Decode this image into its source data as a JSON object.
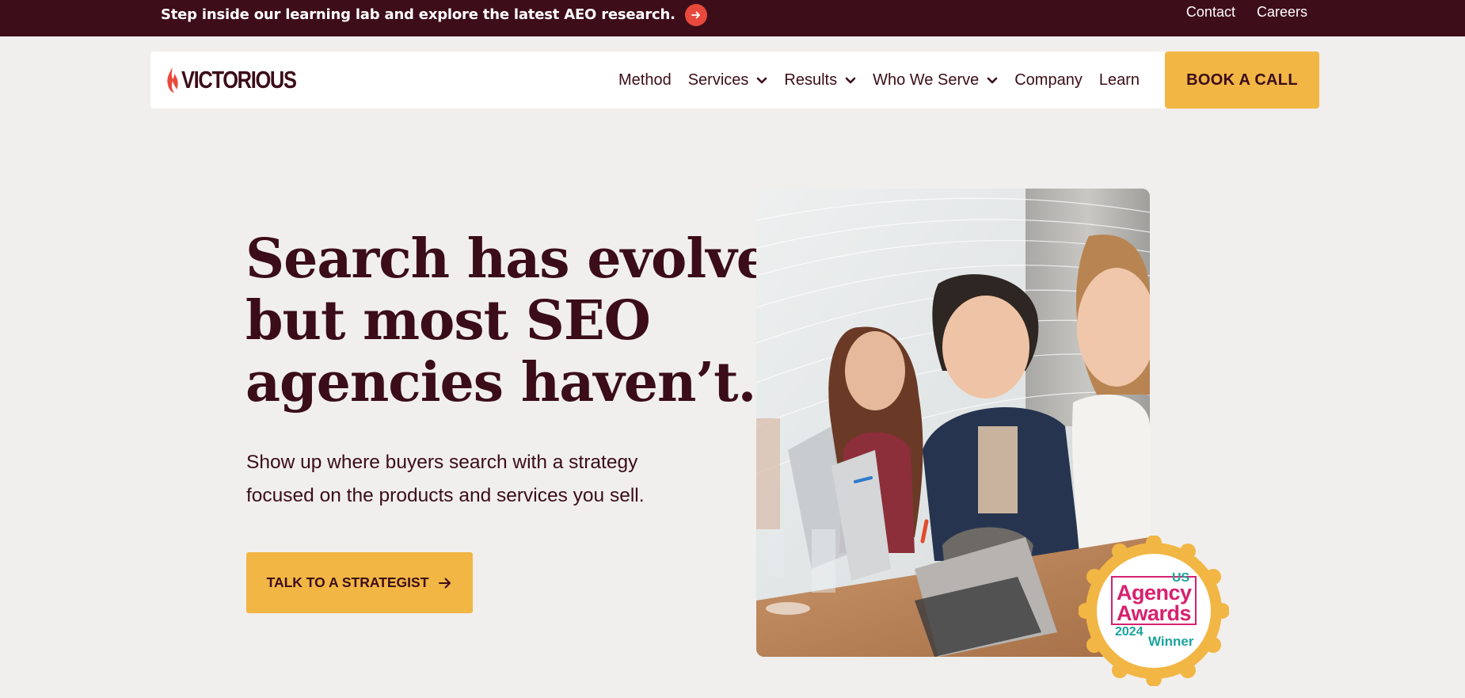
{
  "announcement": {
    "text": "Step inside our learning lab and explore the latest AEO research."
  },
  "top_links": {
    "contact": "Contact",
    "careers": "Careers"
  },
  "nav": {
    "logo_text": "VICTORIOUS",
    "items": [
      {
        "label": "Method",
        "dropdown": false
      },
      {
        "label": "Services",
        "dropdown": true
      },
      {
        "label": "Results",
        "dropdown": true
      },
      {
        "label": "Who We Serve",
        "dropdown": true
      },
      {
        "label": "Company",
        "dropdown": false
      },
      {
        "label": "Learn",
        "dropdown": false
      }
    ],
    "cta_label": "BOOK A CALL"
  },
  "hero": {
    "headline_lines": [
      "Search has evolved,",
      "but most SEO",
      "agencies haven’t."
    ],
    "subtext_lines": [
      "Show up where buyers search with a strategy",
      "focused on the products and services you sell."
    ],
    "cta_label": "TALK TO A STRATEGIST"
  },
  "badge": {
    "country": "US",
    "line1": "Agency",
    "line2": "Awards",
    "year": "2024",
    "status": "Winner"
  },
  "colors": {
    "topbar": "#3e0d1a",
    "accent": "#f2b644",
    "text": "#3b0d18",
    "arrow": "#e9493c",
    "background": "#f0efed"
  }
}
